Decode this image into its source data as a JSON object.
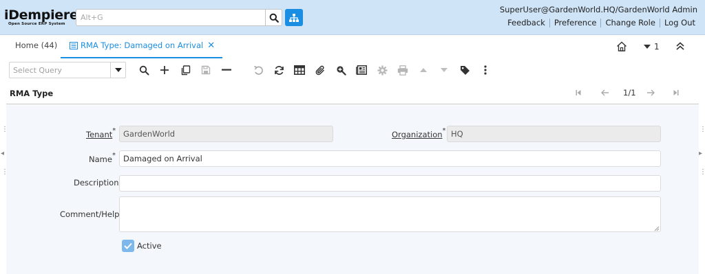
{
  "header": {
    "logo_word": "iDempiere",
    "logo_tagline": "Open Source ERP System",
    "search_placeholder": "Alt+G",
    "user_info": "SuperUser@GardenWorld.HQ/GardenWorld Admin",
    "links": [
      "Feedback",
      "Preference",
      "Change Role",
      "Log Out"
    ]
  },
  "tabs": {
    "home_label": "Home (44)",
    "active_label": "RMA Type: Damaged on Arrival",
    "window_count": "1"
  },
  "toolbar": {
    "query_placeholder": "Select Query",
    "icons": [
      "search-icon",
      "new-record-icon",
      "copy-icon",
      "save-icon",
      "delete-icon",
      "undo-icon",
      "refresh-icon",
      "grid-toggle-icon",
      "attachment-icon",
      "zoom-icon",
      "report-icon",
      "process-icon",
      "print-icon",
      "previous-icon",
      "next-icon",
      "tag-icon",
      "more-icon"
    ]
  },
  "status": {
    "title": "RMA Type",
    "pager": "1/1"
  },
  "form": {
    "tenant_label": "Tenant",
    "tenant_value": "GardenWorld",
    "organization_label": "Organization",
    "organization_value": "HQ",
    "name_label": "Name",
    "name_value": "Damaged on Arrival",
    "description_label": "Description",
    "description_value": "",
    "comment_label": "Comment/Help",
    "comment_value": "",
    "active_label": "Active",
    "active_checked": true,
    "required_marker": "*"
  },
  "colors": {
    "header_bg": "#cfe4f7",
    "accent": "#1a8ee2",
    "form_bg": "#f4f8fc",
    "readonly_bg": "#ebebeb",
    "checkbox": "#7db8ec"
  }
}
